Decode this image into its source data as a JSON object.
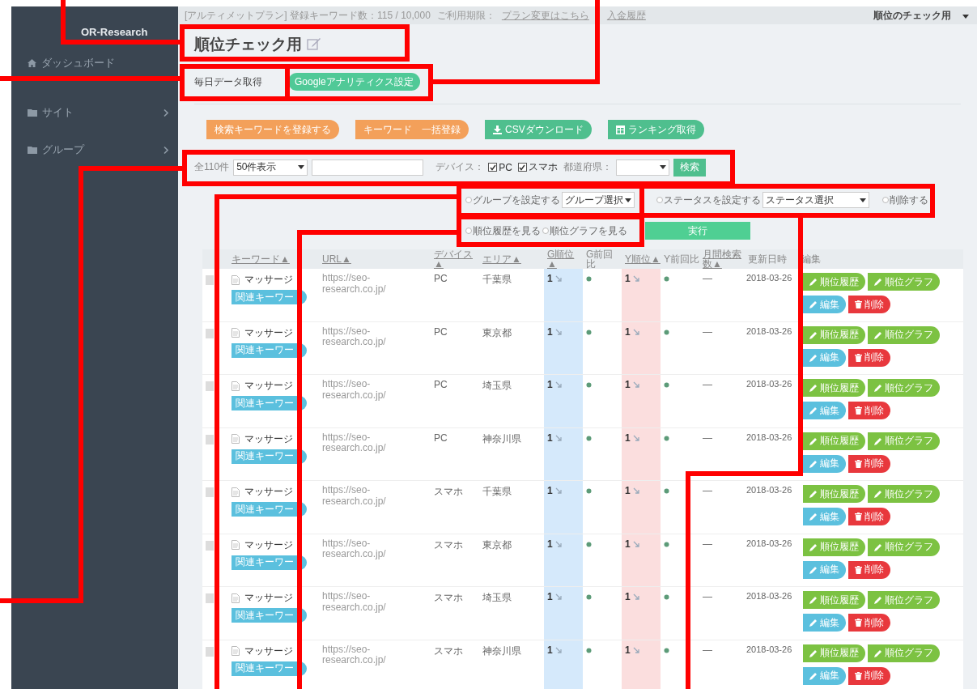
{
  "sidebar": {
    "brand": "OR-Research",
    "items": [
      {
        "label": "ダッシュボード",
        "expandable": false
      },
      {
        "label": "サイト",
        "expandable": true
      },
      {
        "label": "グループ",
        "expandable": true
      }
    ]
  },
  "top_bar": {
    "plan": "[アルティメットプラン] 登録キーワード数：115 / 10,000",
    "expiry": "ご利用期限：",
    "links": [
      "プラン変更はこちら",
      "入金履歴"
    ],
    "account": "順位のチェック用"
  },
  "page_title": "順位チェック用",
  "tabs": [
    {
      "label": "毎日データ取得",
      "selected": false
    },
    {
      "label": "Googleアナリティクス設定",
      "selected": true
    }
  ],
  "actions": [
    {
      "label": "検索キーワードを登録する",
      "kind": "orange"
    },
    {
      "label": "キーワード　一括登録",
      "kind": "orange"
    },
    {
      "label": "CSVダウンロード",
      "kind": "download"
    },
    {
      "label": "ランキング取得",
      "kind": "table"
    }
  ],
  "filter": {
    "count": "全110件",
    "per_page": "50件表示",
    "device_label": "デバイス：",
    "devices": [
      {
        "label": "PC",
        "checked": true
      },
      {
        "label": "スマホ",
        "checked": true
      }
    ],
    "pref_label": "都道府県：",
    "search_button": "検索"
  },
  "bulk": {
    "ops": [
      {
        "kind": "radio",
        "label": "グループを設定する",
        "selected": false
      },
      {
        "kind": "select",
        "label": "グループ選択"
      },
      {
        "kind": "radio",
        "label": "ステータスを設定する",
        "selected": false
      },
      {
        "kind": "select",
        "label": "ステータス選択"
      },
      {
        "kind": "radio",
        "label": "削除する",
        "selected": false
      }
    ],
    "views": [
      {
        "label": "順位履歴を見る",
        "selected": false
      },
      {
        "label": "順位グラフを見る",
        "selected": false
      }
    ],
    "run": "実行"
  },
  "table": {
    "columns": [
      "キーワード▲",
      "URL▲",
      "デバイス▲",
      "エリア▲",
      "G順位▲",
      "G前回比",
      "Y順位▲",
      "Y前回比",
      "月間検索数▲",
      "更新日時",
      "編集"
    ],
    "rows": [
      {
        "checked": false,
        "keyword": "マッサージ",
        "tag": "関連キーワー",
        "url": "https://seo-research.co.jp/",
        "device": "PC",
        "area": "千葉県",
        "g_rank": "1",
        "y_rank": "1",
        "monthly": "—",
        "date": "2018-03-26",
        "buttons": [
          "順位履歴",
          "順位グラフ",
          "編集",
          "削除"
        ]
      },
      {
        "checked": false,
        "keyword": "マッサージ",
        "tag": "関連キーワー",
        "url": "https://seo-research.co.jp/",
        "device": "PC",
        "area": "東京都",
        "g_rank": "1",
        "y_rank": "1",
        "monthly": "—",
        "date": "2018-03-26",
        "buttons": [
          "順位履歴",
          "順位グラフ",
          "編集",
          "削除"
        ]
      },
      {
        "checked": false,
        "keyword": "マッサージ",
        "tag": "関連キーワー",
        "url": "https://seo-research.co.jp/",
        "device": "PC",
        "area": "埼玉県",
        "g_rank": "1",
        "y_rank": "1",
        "monthly": "—",
        "date": "2018-03-26",
        "buttons": [
          "順位履歴",
          "順位グラフ",
          "編集",
          "削除"
        ]
      },
      {
        "checked": false,
        "keyword": "マッサージ",
        "tag": "関連キーワー",
        "url": "https://seo-research.co.jp/",
        "device": "PC",
        "area": "神奈川県",
        "g_rank": "1",
        "y_rank": "1",
        "monthly": "—",
        "date": "2018-03-26",
        "buttons": [
          "順位履歴",
          "順位グラフ",
          "編集",
          "削除"
        ]
      },
      {
        "checked": false,
        "keyword": "マッサージ",
        "tag": "関連キーワー",
        "url": "https://seo-research.co.jp/",
        "device": "スマホ",
        "area": "千葉県",
        "g_rank": "1",
        "y_rank": "1",
        "monthly": "—",
        "date": "2018-03-26",
        "buttons": [
          "順位履歴",
          "順位グラフ",
          "編集",
          "削除"
        ]
      },
      {
        "checked": false,
        "keyword": "マッサージ",
        "tag": "関連キーワー",
        "url": "https://seo-research.co.jp/",
        "device": "スマホ",
        "area": "東京都",
        "g_rank": "1",
        "y_rank": "1",
        "monthly": "—",
        "date": "2018-03-26",
        "buttons": [
          "順位履歴",
          "順位グラフ",
          "編集",
          "削除"
        ]
      },
      {
        "checked": false,
        "keyword": "マッサージ",
        "tag": "関連キーワー",
        "url": "https://seo-research.co.jp/",
        "device": "スマホ",
        "area": "埼玉県",
        "g_rank": "1",
        "y_rank": "1",
        "monthly": "—",
        "date": "2018-03-26",
        "buttons": [
          "順位履歴",
          "順位グラフ",
          "編集",
          "削除"
        ]
      },
      {
        "checked": false,
        "keyword": "マッサージ",
        "tag": "関連キーワー",
        "url": "https://seo-research.co.jp/",
        "device": "スマホ",
        "area": "神奈川県",
        "g_rank": "1",
        "y_rank": "1",
        "monthly": "—",
        "date": "2018-03-26",
        "buttons": [
          "順位履歴",
          "順位グラフ",
          "編集",
          "削除"
        ]
      }
    ]
  }
}
